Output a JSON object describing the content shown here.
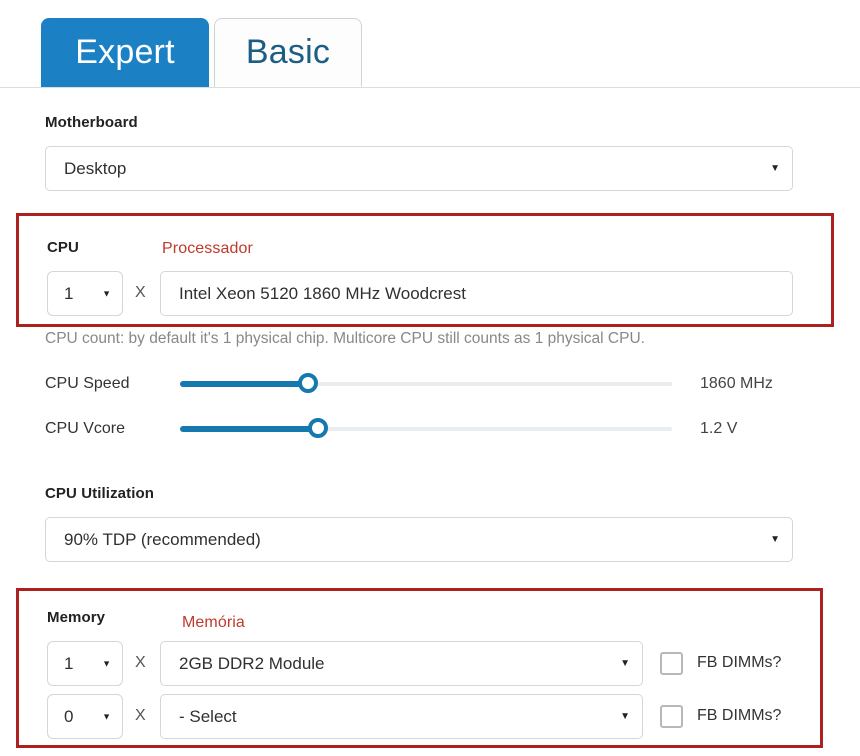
{
  "tabs": [
    {
      "label": "Expert",
      "active": true
    },
    {
      "label": "Basic",
      "active": false
    }
  ],
  "motherboard": {
    "label": "Motherboard",
    "value": "Desktop",
    "caret": "▼"
  },
  "cpu": {
    "label": "CPU",
    "annotation": "Processador",
    "quantity": "1",
    "multiplier": "X",
    "model": "Intel Xeon 5120 1860 MHz Woodcrest",
    "helptext": "CPU count: by default it's 1 physical chip. Multicore CPU still counts as 1 physical CPU.",
    "caret": "▼"
  },
  "sliders": [
    {
      "label": "CPU Speed",
      "value": "1860 MHz",
      "percent": 26
    },
    {
      "label": "CPU Vcore",
      "value": "1.2 V",
      "percent": 28
    }
  ],
  "cpu_utilization": {
    "label": "CPU Utilization",
    "value": "90% TDP (recommended)",
    "caret": "▼"
  },
  "memory": {
    "label": "Memory",
    "annotation": "Memória",
    "multiplier": "X",
    "caret": "▼",
    "rows": [
      {
        "quantity": "1",
        "module": "2GB DDR2 Module",
        "checkbox_label": "FB DIMMs?",
        "checked": false
      },
      {
        "quantity": "0",
        "module": "- Select",
        "checkbox_label": "FB DIMMs?",
        "checked": false
      }
    ]
  },
  "colors": {
    "accent_blue": "#1b80c4",
    "slider_blue": "#1579b0",
    "annotation_red": "#c0392b",
    "redbox_border": "#ad2020"
  }
}
